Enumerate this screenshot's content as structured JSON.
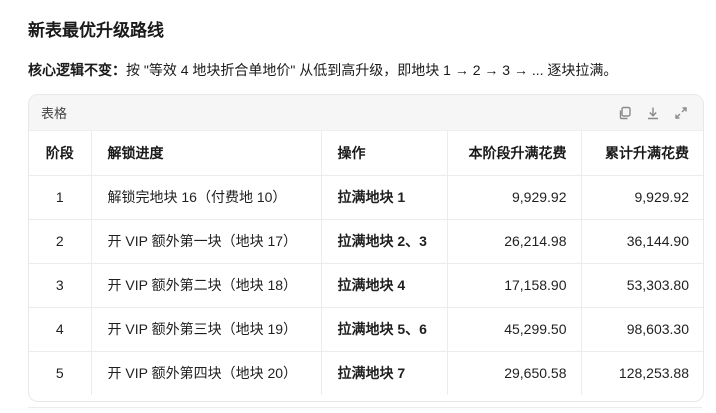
{
  "title": "新表最优升级路线",
  "logic": {
    "label": "核心逻辑不变：",
    "text": "按 \"等效 4 地块折合单地价\" 从低到高升级，即地块 1 → 2 → 3 → ... 逐块拉满。"
  },
  "table_card": {
    "label": "表格",
    "icons": [
      "copy-icon",
      "download-icon",
      "expand-icon"
    ]
  },
  "table": {
    "headers": [
      "阶段",
      "解锁进度",
      "操作",
      "本阶段升满花费",
      "累计升满花费"
    ],
    "rows": [
      [
        "1",
        "解锁完地块 16（付费地 10）",
        "拉满地块 1",
        "9,929.92",
        "9,929.92"
      ],
      [
        "2",
        "开 VIP 额外第一块（地块 17）",
        "拉满地块 2、3",
        "26,214.98",
        "36,144.90"
      ],
      [
        "3",
        "开 VIP 额外第二块（地块 18）",
        "拉满地块 4",
        "17,158.90",
        "53,303.80"
      ],
      [
        "4",
        "开 VIP 额外第三块（地块 19）",
        "拉满地块 5、6",
        "45,299.50",
        "98,603.30"
      ],
      [
        "5",
        "开 VIP 额外第四块（地块 20）",
        "拉满地块 7",
        "29,650.58",
        "128,253.88"
      ]
    ]
  }
}
